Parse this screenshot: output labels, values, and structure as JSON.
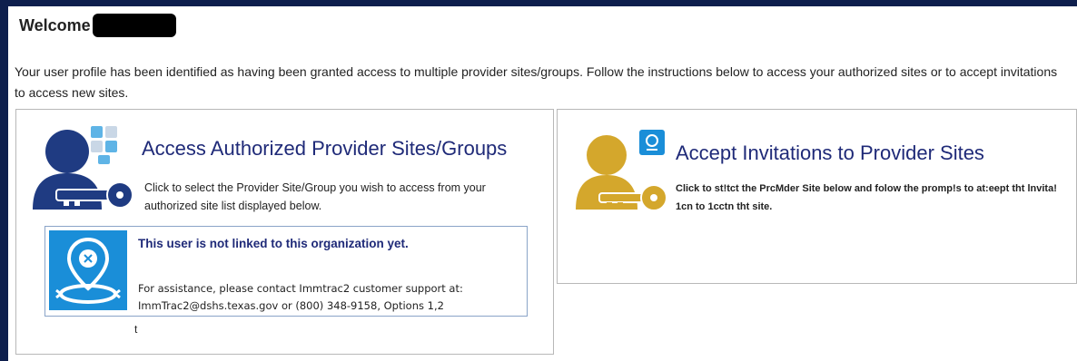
{
  "header": {
    "welcome_label": "Welcome"
  },
  "intro": {
    "line1": "Your user profile has been identified as having been granted access to multiple provider sites/groups. Follow the instructions below to access your authorized sites or to accept invitations",
    "line2": "to access new sites."
  },
  "access_card": {
    "title": "Access Authorized Provider Sites/Groups",
    "desc_line1": "Click to select the Provider Site/Group you wish to access from your",
    "desc_line2": "authorized site list displayed below.",
    "icon": "user-key-icon",
    "icon_color": "#1f3b82",
    "notice": {
      "icon": "location-pin-icon",
      "title": "This user is not linked to this organization yet.",
      "text_line1": "For assistance, please contact Immtrac2 customer support at:",
      "text_line2": "ImmTrac2@dshs.texas.gov or (800) 348-9158, Options 1,2"
    },
    "stray_mark": "t"
  },
  "invite_card": {
    "title": "Accept Invitations to Provider Sites",
    "desc_line1": "Click to st!tct the PrcMder Site below and folow the promp!s to at:eept tht lnvita!",
    "desc_line2": "1cn to 1cctn tht site.",
    "icon": "user-key-icon",
    "icon_color": "#d4a72c"
  },
  "colors": {
    "frame": "#0e1f4d",
    "title_blue": "#1f2a78",
    "notice_icon_bg": "#1a8ed8"
  }
}
